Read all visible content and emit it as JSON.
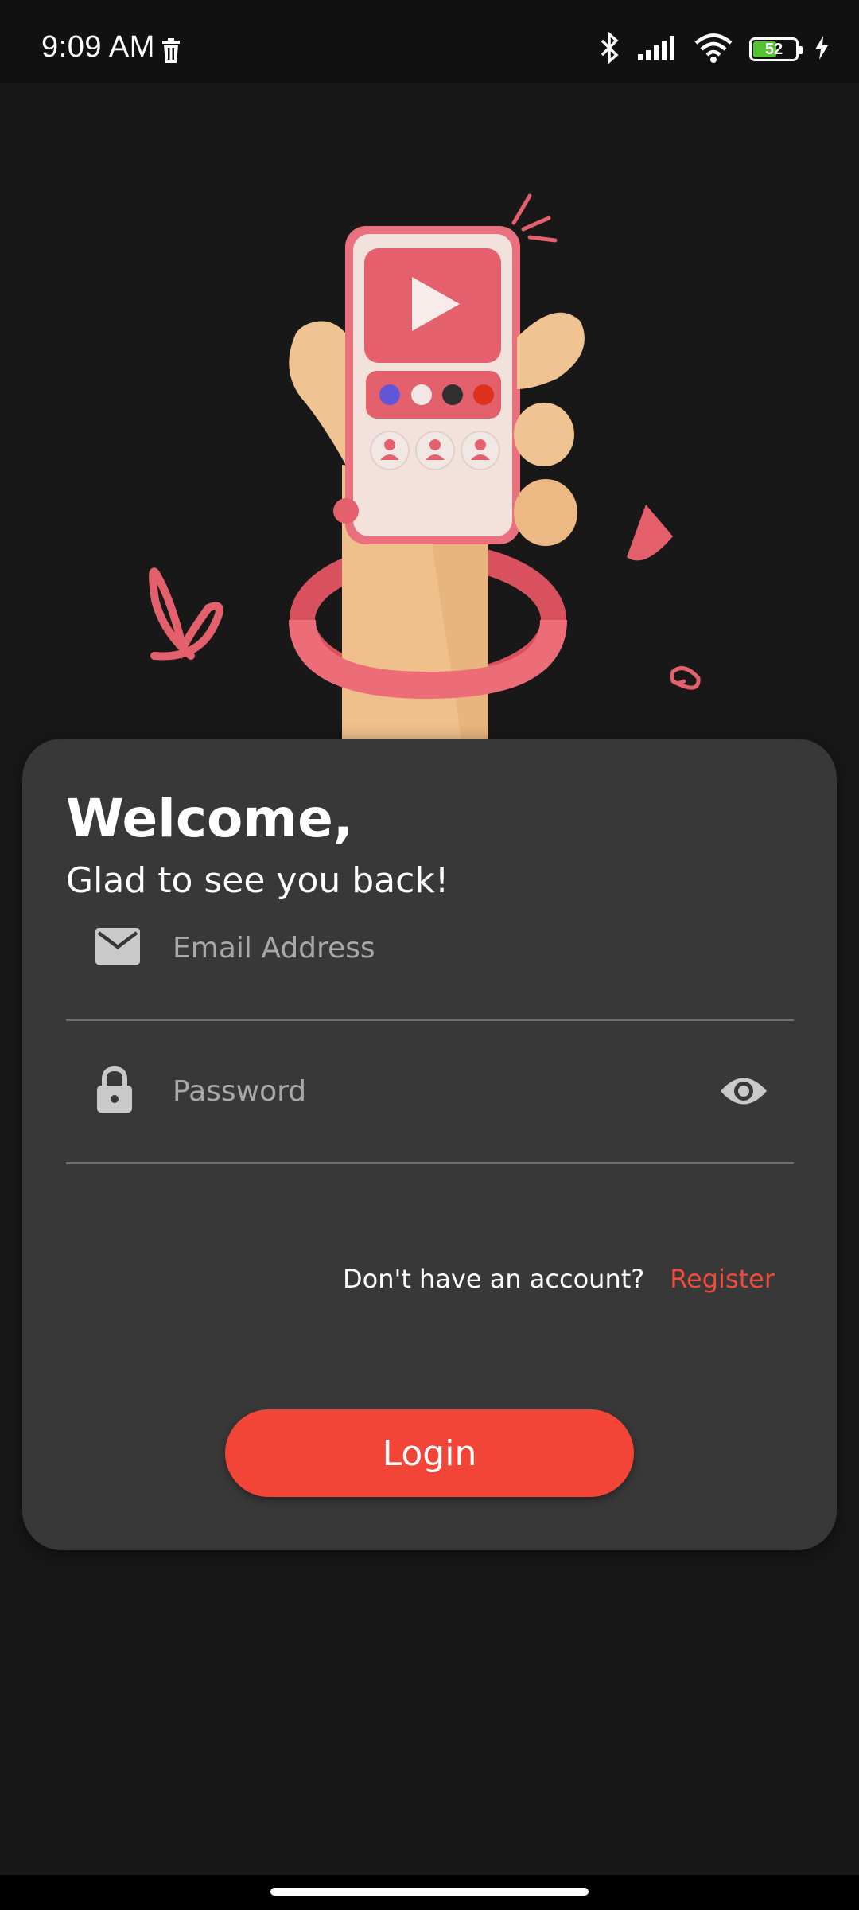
{
  "status_bar": {
    "time": "9:09 AM",
    "battery_level": "52",
    "battery_fraction": 0.52,
    "icons": [
      "trash-icon",
      "bluetooth-icon",
      "signal-icon",
      "wifi-icon",
      "battery-icon",
      "charging-icon"
    ]
  },
  "illustration": {
    "subject": "hand-holding-phone",
    "colors": {
      "accent": "#e8606f",
      "skin": "#f0c392",
      "phone": "#f3e2dc"
    }
  },
  "login_card": {
    "title": "Welcome,",
    "subtitle": "Glad to see you back!",
    "email": {
      "placeholder": "Email Address",
      "value": "",
      "icon": "email-icon"
    },
    "password": {
      "placeholder": "Password",
      "value": "",
      "icon": "lock-icon",
      "toggle_icon": "eye-icon"
    },
    "register_prompt": "Don't have an account?",
    "register_link": "Register",
    "login_button": "Login"
  },
  "colors": {
    "background": "#181818",
    "card": "#383838",
    "accent": "#f24437"
  }
}
